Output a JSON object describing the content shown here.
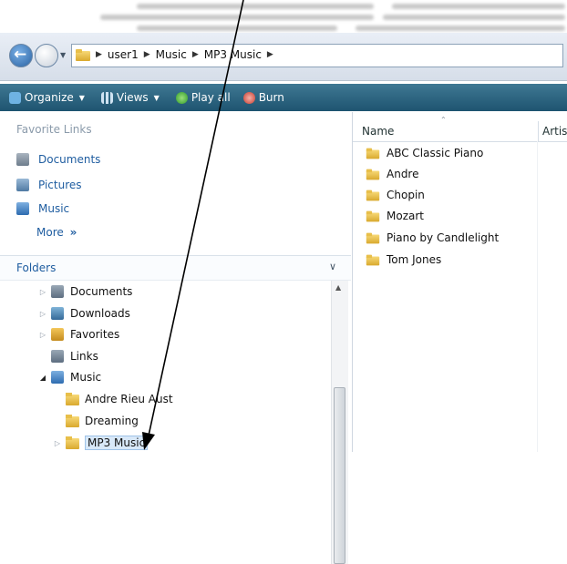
{
  "address": {
    "breadcrumbs": [
      "user1",
      "Music",
      "MP3 Music"
    ]
  },
  "toolbar": {
    "organize": "Organize",
    "views": "Views",
    "play_all": "Play all",
    "burn": "Burn"
  },
  "favorites": {
    "title": "Favorite Links",
    "items": [
      "Documents",
      "Pictures",
      "Music"
    ],
    "more": "More"
  },
  "folders": {
    "title": "Folders",
    "tree": [
      "Documents",
      "Downloads",
      "Favorites",
      "Links",
      "Music",
      "Andre Rieu Aust",
      "Dreaming",
      "MP3 Music"
    ]
  },
  "columns": {
    "name": "Name",
    "artist": "Artis"
  },
  "files": [
    "ABC Classic Piano",
    "Andre",
    "Chopin",
    "Mozart",
    "Piano by Candlelight",
    "Tom Jones"
  ],
  "colors": {
    "toolbar": "#2b6480",
    "link": "#1f5da0",
    "folder": "#e8bf4a"
  }
}
